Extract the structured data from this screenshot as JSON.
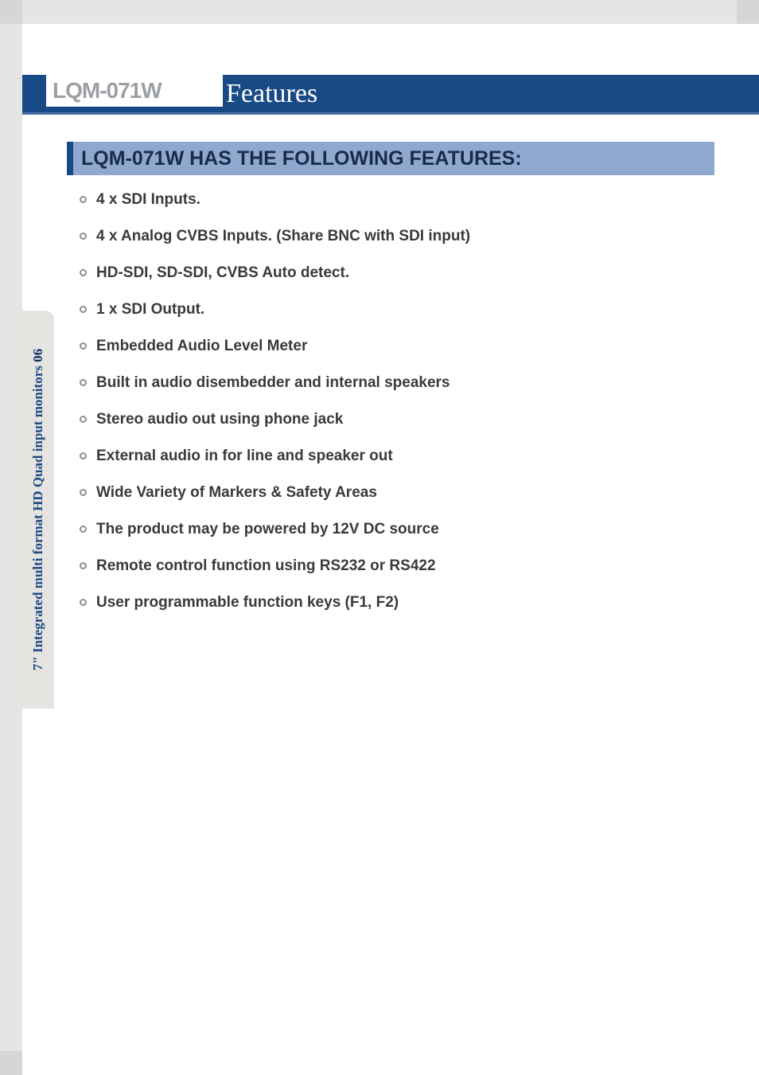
{
  "model": "LQM-071W",
  "header_title": "Features",
  "side_tab": {
    "text": "7\" Integrated multi format HD Quad input monitors",
    "page_number": "06"
  },
  "section_heading": "LQM-071W HAS THE FOLLOWING FEATURES:",
  "features": [
    "4 x SDI Inputs.",
    "4 x Analog CVBS Inputs. (Share BNC with SDI input)",
    "HD-SDI, SD-SDI, CVBS Auto detect.",
    "1 x SDI Output.",
    "Embedded Audio Level Meter",
    "Built in audio disembedder and internal speakers",
    "Stereo audio out using phone jack",
    "External audio in for line and speaker out",
    "Wide Variety of Markers & Safety Areas",
    "The product may be powered by 12V DC source",
    "Remote control function using RS232 or RS422",
    "User programmable function keys (F1, F2)"
  ]
}
